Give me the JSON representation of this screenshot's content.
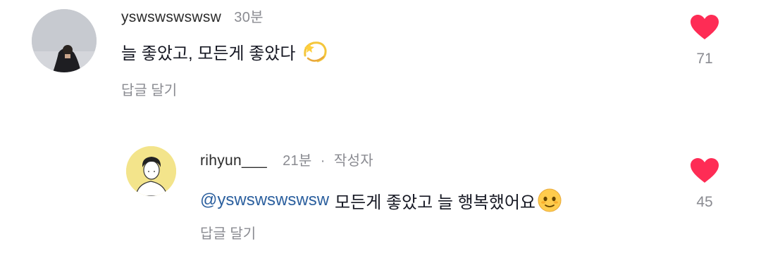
{
  "comments": [
    {
      "username": "yswswswswsw",
      "time": "30분",
      "text": "늘 좋았고, 모든게 좋았다",
      "emoji": "dizzy-star-emoji",
      "reply_label": "답글 달기",
      "likes": "71",
      "heart_color": "#fe2c55"
    },
    {
      "username": "rihyun___",
      "time": "21분",
      "separator": "·",
      "author_badge": "작성자",
      "mention": "@yswswswswsw",
      "text": "모든게 좋았고 늘 행복했어요",
      "emoji": "smiling-face-with-tear-emoji",
      "reply_label": "답글 달기",
      "likes": "45",
      "heart_color": "#fe2c55"
    }
  ]
}
